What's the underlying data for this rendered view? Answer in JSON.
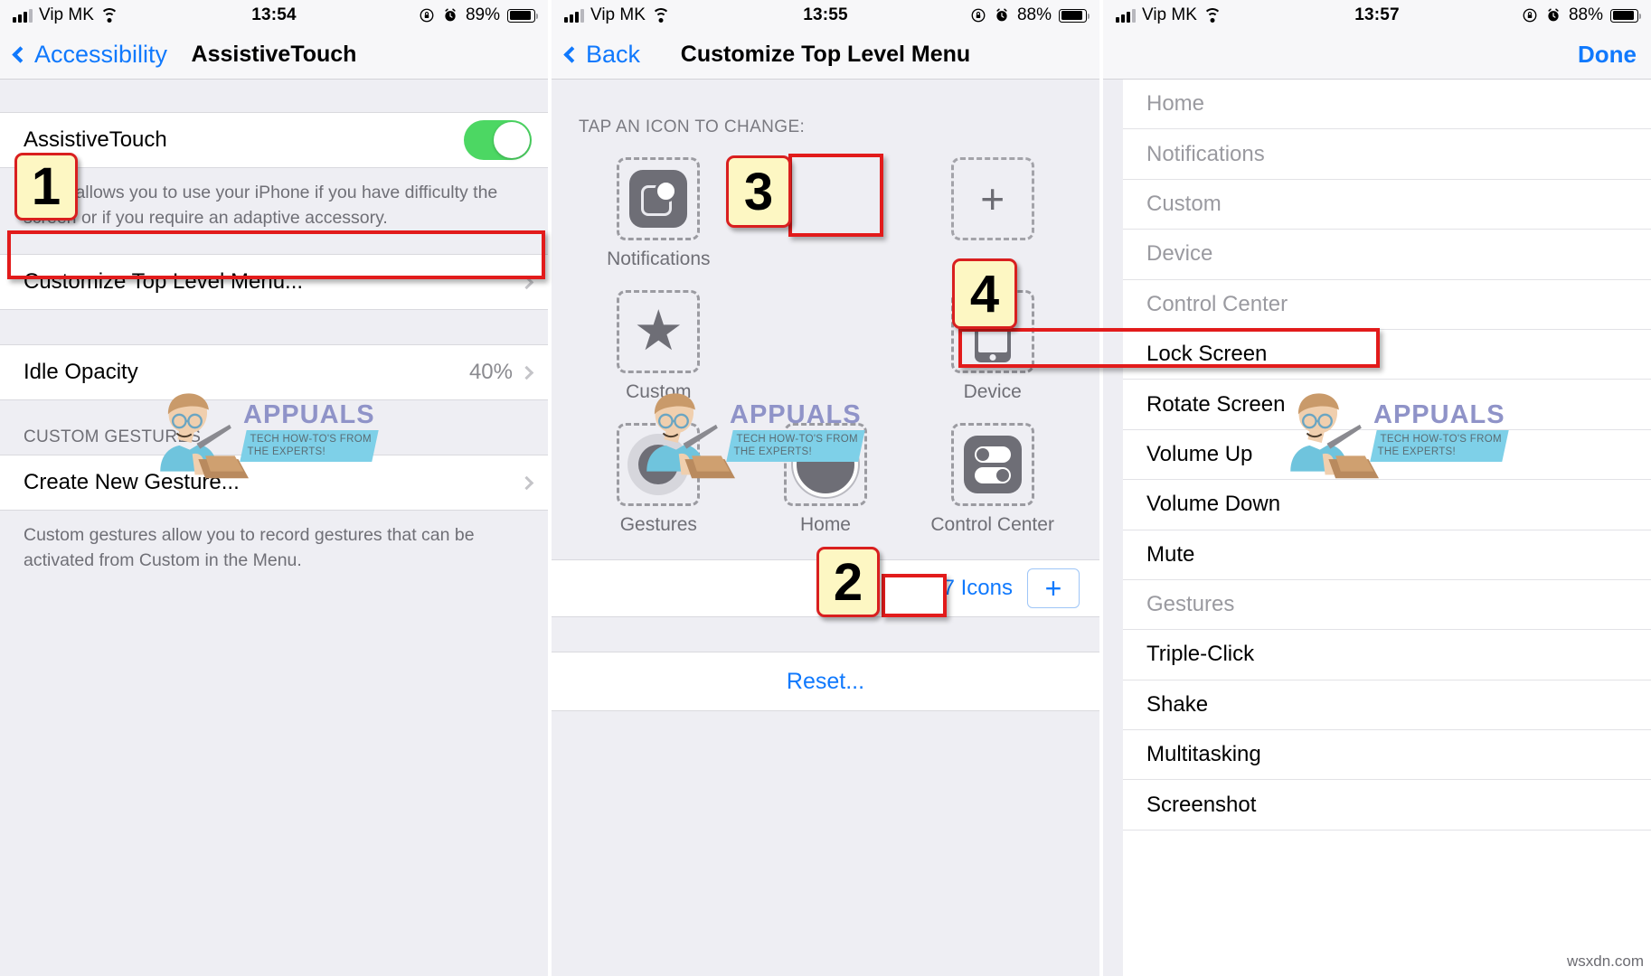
{
  "watermarks": {
    "brand": "APPUALS",
    "tagline_line1": "TECH HOW-TO'S FROM",
    "tagline_line2": "THE EXPERTS!",
    "site": "wsxdn.com"
  },
  "panel1": {
    "status": {
      "carrier": "Vip MK",
      "time": "13:54",
      "battery_pct": "89%",
      "signal_icon": "cellular-bars-icon",
      "wifi_icon": "wifi-icon",
      "rotation_lock_icon": "rotation-lock-icon",
      "alarm_icon": "alarm-clock-icon",
      "battery_icon": "battery-icon"
    },
    "nav": {
      "back_label": "Accessibility",
      "title": "AssistiveTouch"
    },
    "rows": [
      {
        "label": "AssistiveTouch",
        "type": "toggle",
        "toggle_on": true
      },
      {
        "label": "Customize Top Level Menu...",
        "type": "link"
      },
      {
        "label": "Idle Opacity",
        "value": "40%",
        "type": "link"
      },
      {
        "label": "Create New Gesture...",
        "type": "link"
      }
    ],
    "assistive_note": "Touch allows you to use your iPhone if you have difficulty the screen or if you require an adaptive accessory.",
    "section_header": "CUSTOM GESTURES",
    "gestures_note": "Custom gestures allow you to record gestures that can be activated from Custom in the Menu."
  },
  "panel2": {
    "status": {
      "carrier": "Vip MK",
      "time": "13:55",
      "battery_pct": "88%"
    },
    "nav": {
      "back_label": "Back",
      "title": "Customize Top Level Menu"
    },
    "tap_header": "TAP AN ICON TO CHANGE:",
    "grid": [
      {
        "label": "Notifications",
        "icon": "notifications-icon",
        "empty": false
      },
      {
        "label": "",
        "icon": "",
        "empty": null
      },
      {
        "label": "",
        "icon": "plus-icon",
        "empty": true
      },
      {
        "label": "Custom",
        "icon": "star-icon",
        "empty": false
      },
      {
        "label": "",
        "icon": "",
        "empty": null
      },
      {
        "label": "Device",
        "icon": "device-icon",
        "empty": false
      },
      {
        "label": "Gestures",
        "icon": "gestures-icon",
        "empty": false
      },
      {
        "label": "Home",
        "icon": "home-icon",
        "empty": false
      },
      {
        "label": "Control Center",
        "icon": "control-center-icon",
        "empty": false
      }
    ],
    "icons_count_label": "7 Icons",
    "add_icon_label": "+",
    "reset_label": "Reset..."
  },
  "panel3": {
    "status": {
      "carrier": "Vip MK",
      "time": "13:57",
      "battery_pct": "88%"
    },
    "nav": {
      "done_label": "Done"
    },
    "options": [
      {
        "label": "Home",
        "disabled": true
      },
      {
        "label": "Notifications",
        "disabled": true
      },
      {
        "label": "Custom",
        "disabled": true
      },
      {
        "label": "Device",
        "disabled": true
      },
      {
        "label": "Control Center",
        "disabled": true
      },
      {
        "label": "Lock Screen",
        "disabled": false
      },
      {
        "label": "Rotate Screen",
        "disabled": false
      },
      {
        "label": "Volume Up",
        "disabled": false
      },
      {
        "label": "Volume Down",
        "disabled": false
      },
      {
        "label": "Mute",
        "disabled": false
      },
      {
        "label": "Gestures",
        "disabled": true
      },
      {
        "label": "Triple-Click",
        "disabled": false
      },
      {
        "label": "Shake",
        "disabled": false
      },
      {
        "label": "Multitasking",
        "disabled": false
      },
      {
        "label": "Screenshot",
        "disabled": false
      }
    ]
  },
  "annotations": {
    "badges": [
      {
        "number": "1"
      },
      {
        "number": "2"
      },
      {
        "number": "3"
      },
      {
        "number": "4"
      }
    ],
    "accent_color": "#e21b1b",
    "badge_fill": "#fdf7c3"
  }
}
